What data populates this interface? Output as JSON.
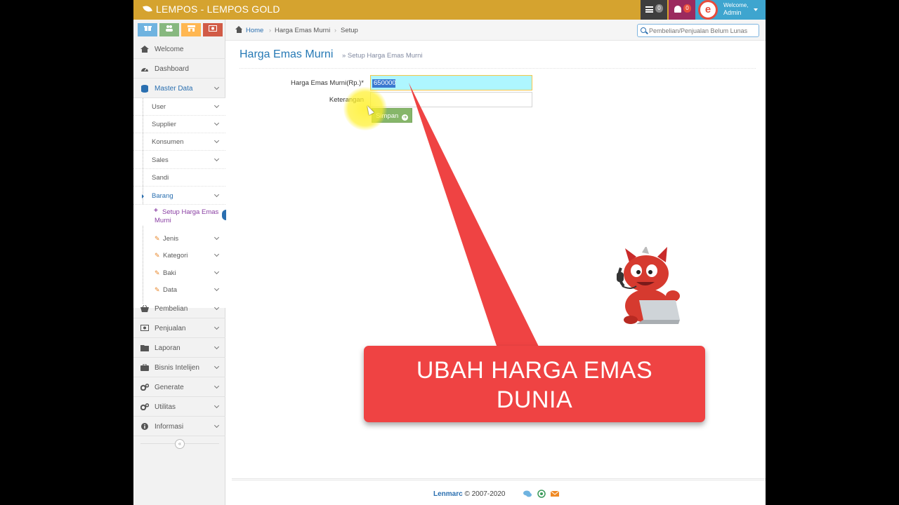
{
  "navbar": {
    "brand": "LEMPOS - LEMPOS GOLD",
    "tasks_count": "0",
    "notif_count": "0",
    "welcome": "Welcome,",
    "user": "Admin"
  },
  "sidebar": {
    "items": [
      {
        "label": "Welcome",
        "icon": "home-icon"
      },
      {
        "label": "Dashboard",
        "icon": "tachometer-icon"
      },
      {
        "label": "Master Data",
        "icon": "database-icon"
      },
      {
        "label": "Pembelian",
        "icon": "basket-icon"
      },
      {
        "label": "Penjualan",
        "icon": "money-icon"
      },
      {
        "label": "Laporan",
        "icon": "folder-icon"
      },
      {
        "label": "Bisnis Intelijen",
        "icon": "briefcase-icon"
      },
      {
        "label": "Generate",
        "icon": "cogs-icon"
      },
      {
        "label": "Utilitas",
        "icon": "cogs-icon"
      },
      {
        "label": "Informasi",
        "icon": "info-icon"
      }
    ],
    "master_sub": [
      "User",
      "Supplier",
      "Konsumen",
      "Sales",
      "Sandi",
      "Barang"
    ],
    "barang_sub": [
      "Setup Harga Emas Murni",
      "Jenis",
      "Kategori",
      "Baki",
      "Data"
    ]
  },
  "breadcrumb": {
    "home": "Home",
    "page": "Harga Emas Murni",
    "current": "Setup"
  },
  "search": {
    "placeholder": "Pembelian/Penjualan Belum Lunas"
  },
  "page": {
    "title": "Harga Emas Murni",
    "subtitle": "» Setup Harga Emas Murni"
  },
  "form": {
    "price_label": "Harga Emas Murni(Rp.)*",
    "price_value": "650000",
    "note_label": "Keterangan",
    "note_value": "",
    "save_label": "Simpan"
  },
  "footer": {
    "brand": "Lenmarc",
    "copyright": "© 2007-2020"
  },
  "callout": {
    "line1": "UBAH HARGA EMAS",
    "line2": "DUNIA"
  },
  "colors": {
    "navbar": "#d5a32f",
    "accent": "#2679b5",
    "callout": "#ef4343"
  }
}
